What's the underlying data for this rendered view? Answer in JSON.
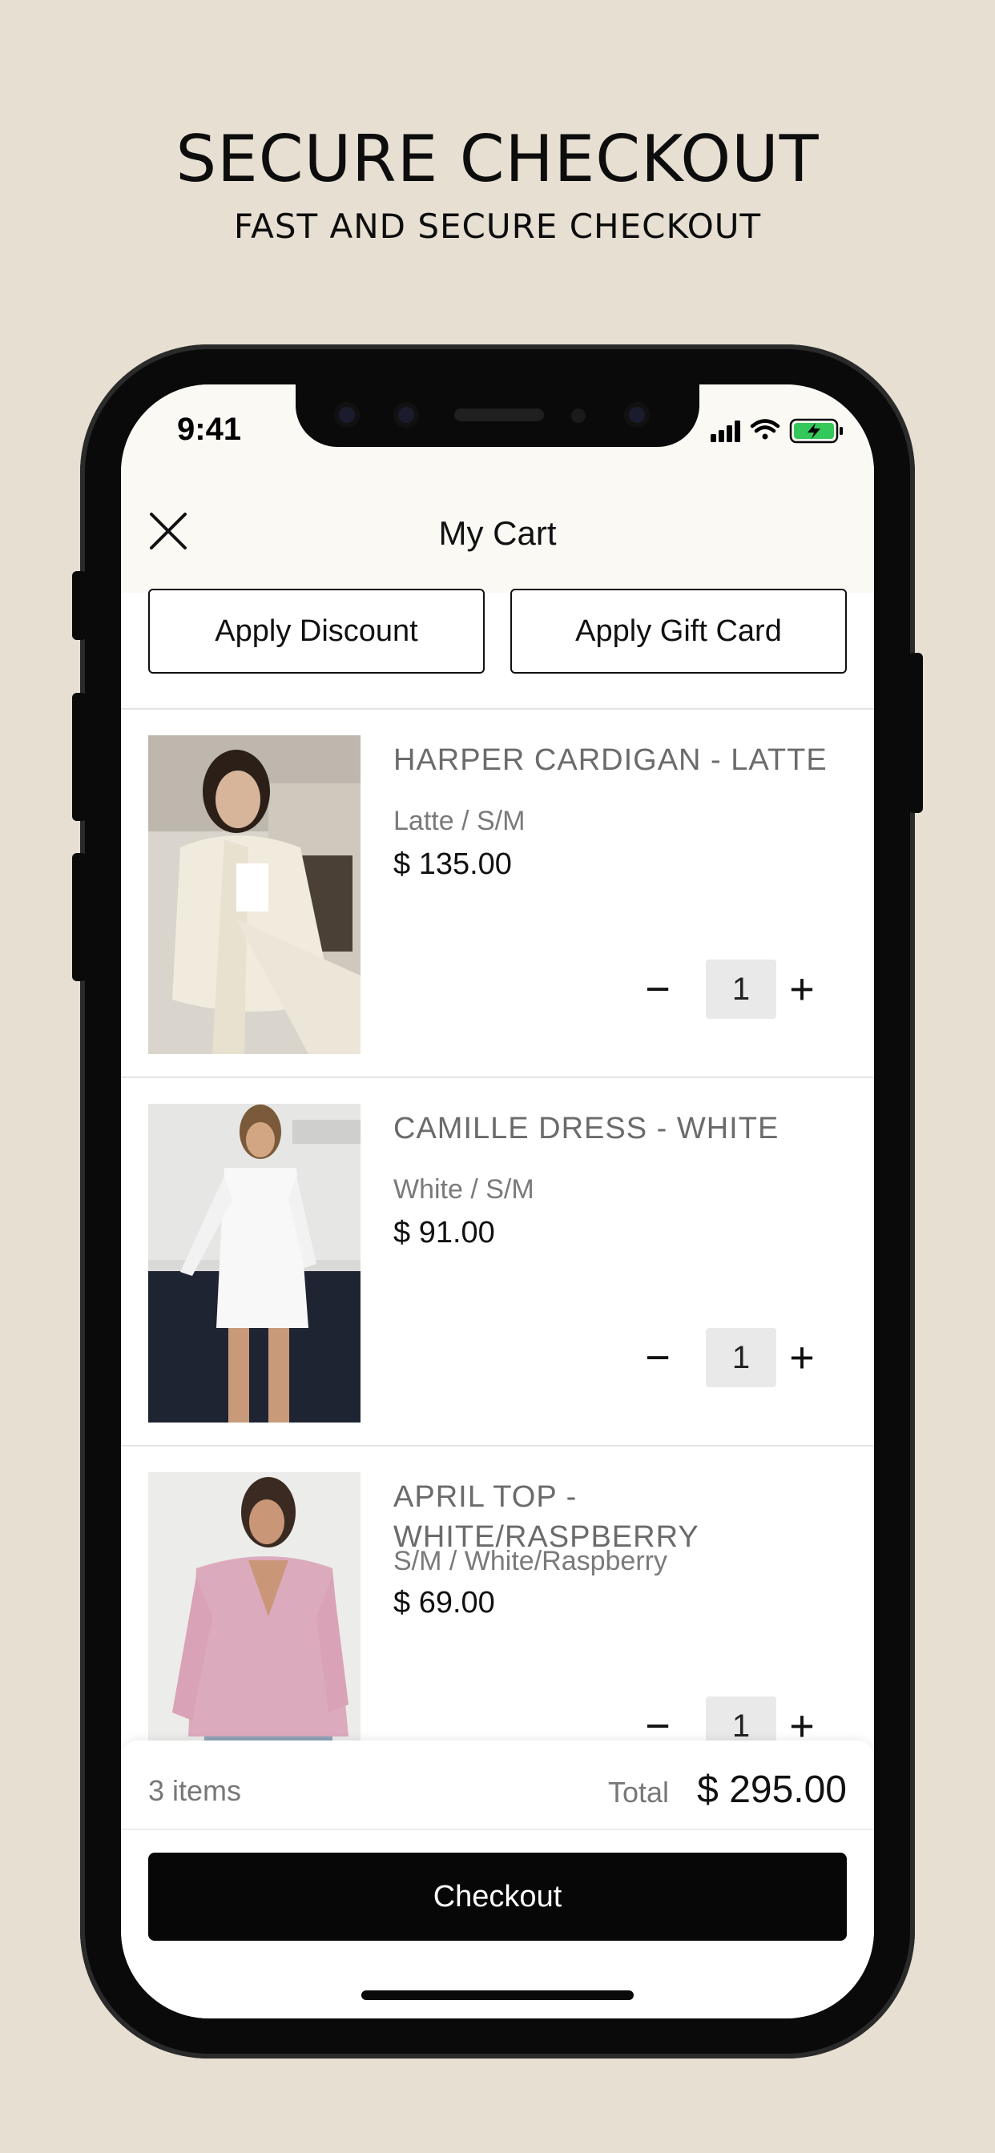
{
  "promo": {
    "headline": "SECURE CHECKOUT",
    "subheadline": "FAST AND SECURE CHECKOUT"
  },
  "status_bar": {
    "time": "9:41",
    "icons": [
      "signal-icon",
      "wifi-icon",
      "battery-charging-icon"
    ]
  },
  "nav": {
    "title": "My Cart",
    "close_icon": "close-icon"
  },
  "actions": {
    "apply_discount": "Apply Discount",
    "apply_gift_card": "Apply Gift Card"
  },
  "cart_items": [
    {
      "title": "HARPER CARDIGAN - LATTE",
      "variant": "Latte / S/M",
      "price": "$ 135.00",
      "quantity": "1"
    },
    {
      "title": "CAMILLE DRESS - WHITE",
      "variant": "White / S/M",
      "price": "$ 91.00",
      "quantity": "1"
    },
    {
      "title": "APRIL TOP - WHITE/RASPBERRY",
      "variant": "S/M / White/Raspberry",
      "price": "$ 69.00",
      "quantity": "1"
    }
  ],
  "qty_controls": {
    "minus": "−",
    "plus": "+"
  },
  "summary": {
    "items_count": "3 items",
    "total_label": "Total",
    "total_value": "$ 295.00",
    "checkout_label": "Checkout"
  },
  "colors": {
    "page_background": "#e6dfd2",
    "header_background": "#faf9f4",
    "checkout_button": "#070707",
    "battery_green": "#34c759"
  }
}
